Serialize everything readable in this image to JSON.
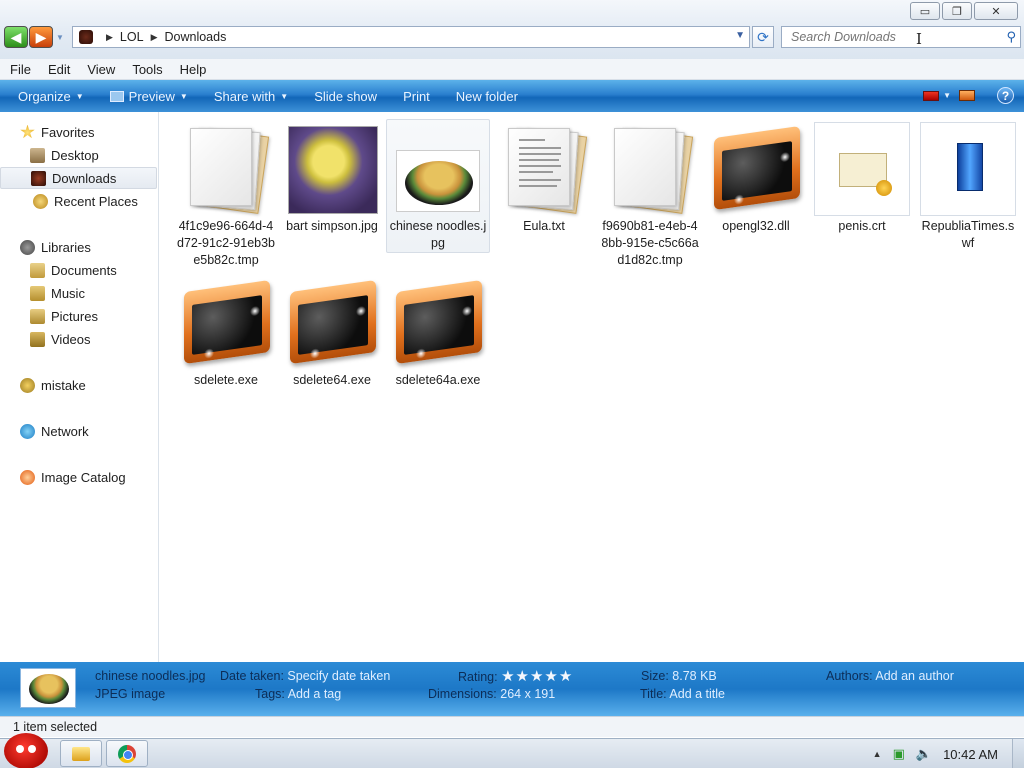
{
  "window": {
    "caption_buttons": [
      "minimize-icon",
      "restore-icon",
      "close-icon"
    ]
  },
  "address": {
    "crumbs": [
      "LOL",
      "Downloads"
    ]
  },
  "search": {
    "placeholder": "Search Downloads"
  },
  "menu": [
    "File",
    "Edit",
    "View",
    "Tools",
    "Help"
  ],
  "toolbar": {
    "organize": "Organize",
    "preview": "Preview",
    "share": "Share with",
    "slideshow": "Slide show",
    "print": "Print",
    "new_folder": "New folder"
  },
  "sidebar": {
    "favorites": "Favorites",
    "desktop": "Desktop",
    "downloads": "Downloads",
    "recent": "Recent Places",
    "libraries": "Libraries",
    "documents": "Documents",
    "music": "Music",
    "pictures": "Pictures",
    "videos": "Videos",
    "user": "mistake",
    "network": "Network",
    "catalog": "Image Catalog"
  },
  "files": [
    {
      "name": "4f1c9e96-664d-4d72-91c2-91eb3be5b82c.tmp",
      "icon": "tmp-file-icon"
    },
    {
      "name": "bart simpson.jpg",
      "icon": "image-thumbnail"
    },
    {
      "name": "chinese noodles.jpg",
      "icon": "image-thumbnail"
    },
    {
      "name": "Eula.txt",
      "icon": "text-file-icon"
    },
    {
      "name": "f9690b81-e4eb-48bb-915e-c5c66ad1d82c.tmp",
      "icon": "tmp-file-icon"
    },
    {
      "name": "opengl32.dll",
      "icon": "application-icon"
    },
    {
      "name": "penis.crt",
      "icon": "certificate-icon"
    },
    {
      "name": "RepubliaTimes.swf",
      "icon": "flash-file-icon"
    },
    {
      "name": "sdelete.exe",
      "icon": "application-icon"
    },
    {
      "name": "sdelete64.exe",
      "icon": "application-icon"
    },
    {
      "name": "sdelete64a.exe",
      "icon": "application-icon"
    }
  ],
  "details": {
    "filename": "chinese noodles.jpg",
    "filetype": "JPEG image",
    "date_key": "Date taken:",
    "date_val": "Specify date taken",
    "tags_key": "Tags:",
    "tags_val": "Add a tag",
    "rating_key": "Rating:",
    "rating_stars": "★★★★★",
    "rating_value": 0,
    "dims_key": "Dimensions:",
    "dims_val": "264 x 191",
    "size_key": "Size:",
    "size_val": "8.78 KB",
    "title_key": "Title:",
    "title_val": "Add a title",
    "authors_key": "Authors:",
    "authors_val": "Add an author"
  },
  "status": {
    "text": "1 item selected"
  },
  "taskbar": {
    "clock": "10:42 AM"
  }
}
